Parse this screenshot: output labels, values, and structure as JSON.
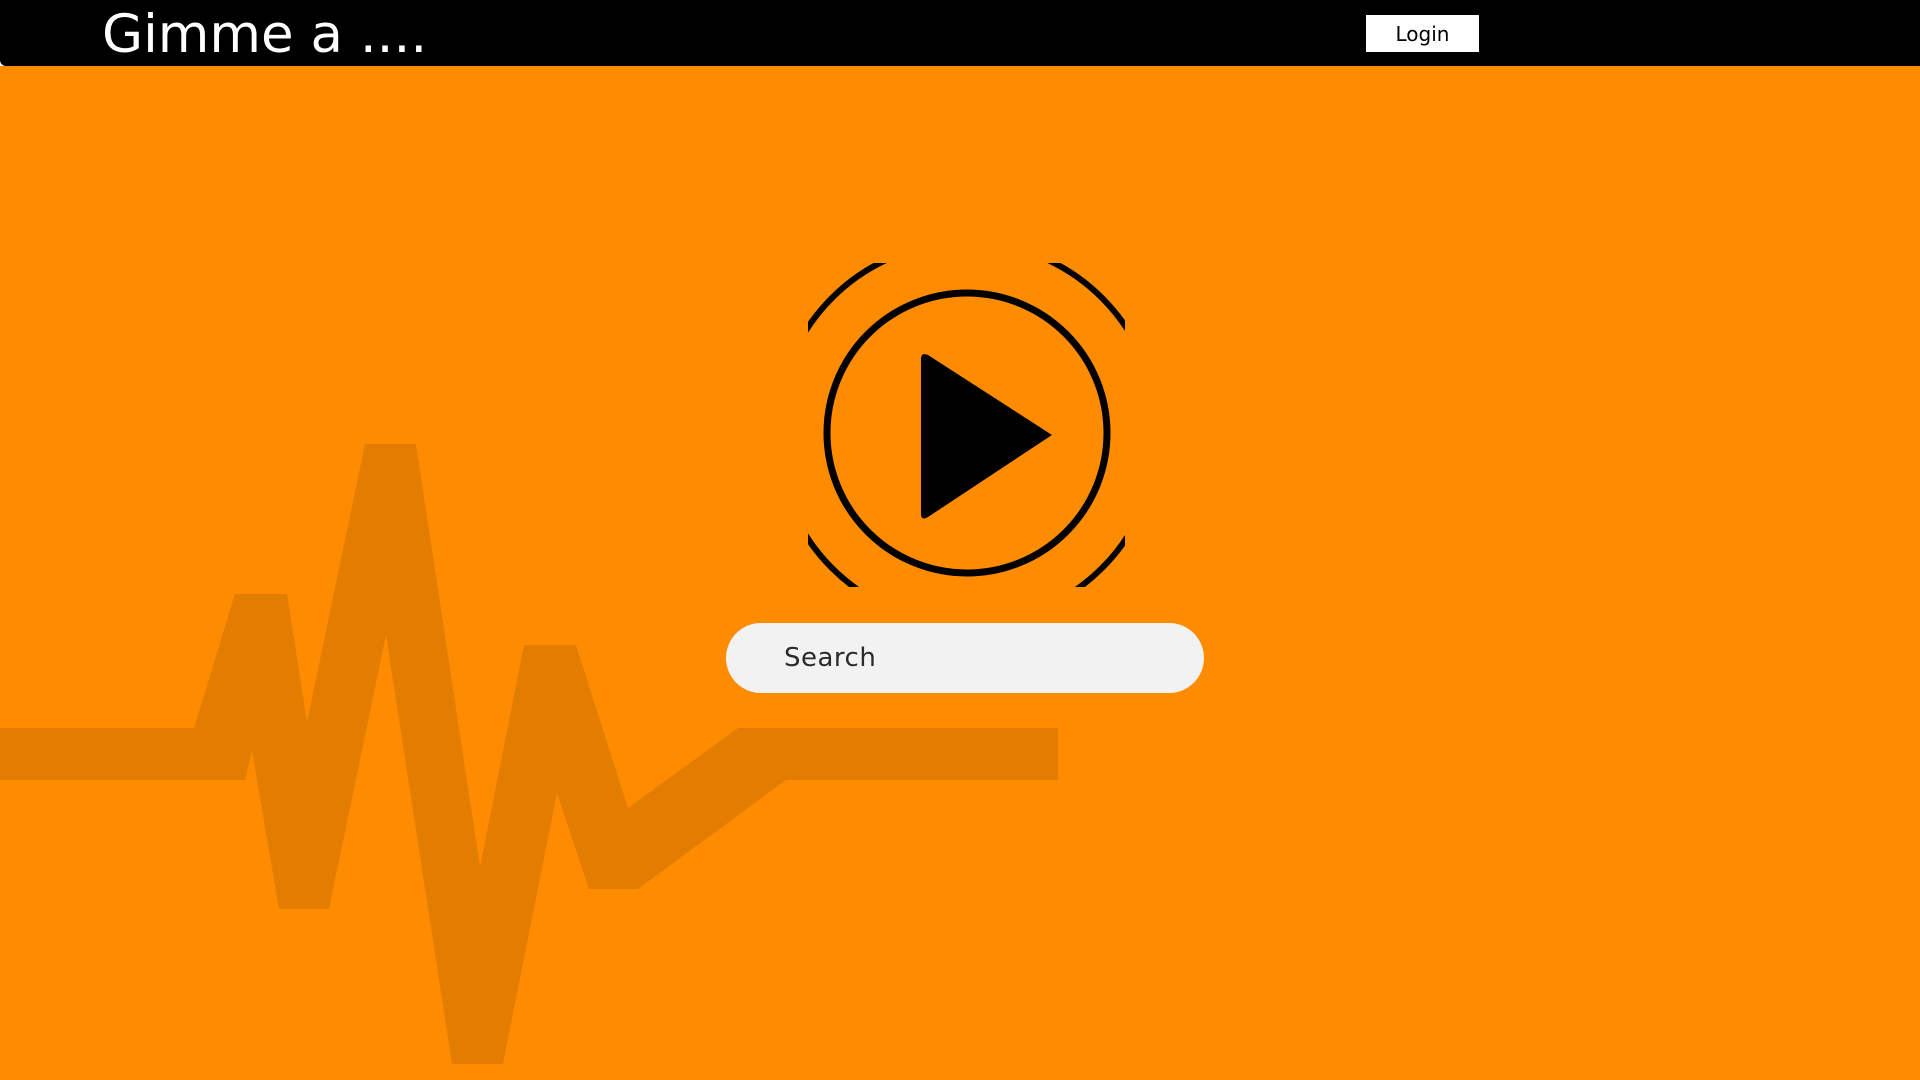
{
  "header": {
    "site_title": "Gimme a ....",
    "login_label": "Login"
  },
  "search": {
    "placeholder": "Search"
  },
  "icons": {
    "logo": "play-button-icon",
    "background": "heartbeat-waveform"
  },
  "colors": {
    "header_bg": "#000000",
    "main_bg": "#ff8c00",
    "waveform": "#e37d00",
    "search_bg": "#f2f2f2",
    "logo": "#000000"
  }
}
